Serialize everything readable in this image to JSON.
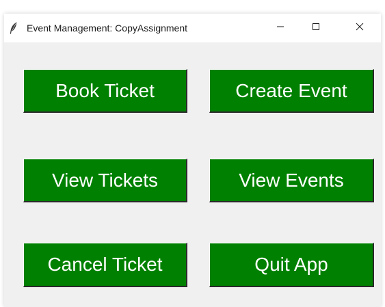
{
  "window": {
    "title": "Event Management: CopyAssignment",
    "app_icon": "feather-icon"
  },
  "controls": {
    "minimize": "minimize-icon",
    "maximize": "maximize-icon",
    "close": "close-icon"
  },
  "colors": {
    "button_bg": "#008000",
    "button_text": "#ffffff",
    "window_bg": "#f0f0f0"
  },
  "buttons": {
    "book_ticket": "Book Ticket",
    "create_event": "Create Event",
    "view_tickets": "View Tickets",
    "view_events": "View Events",
    "cancel_ticket": "Cancel Ticket",
    "quit_app": "Quit App"
  }
}
